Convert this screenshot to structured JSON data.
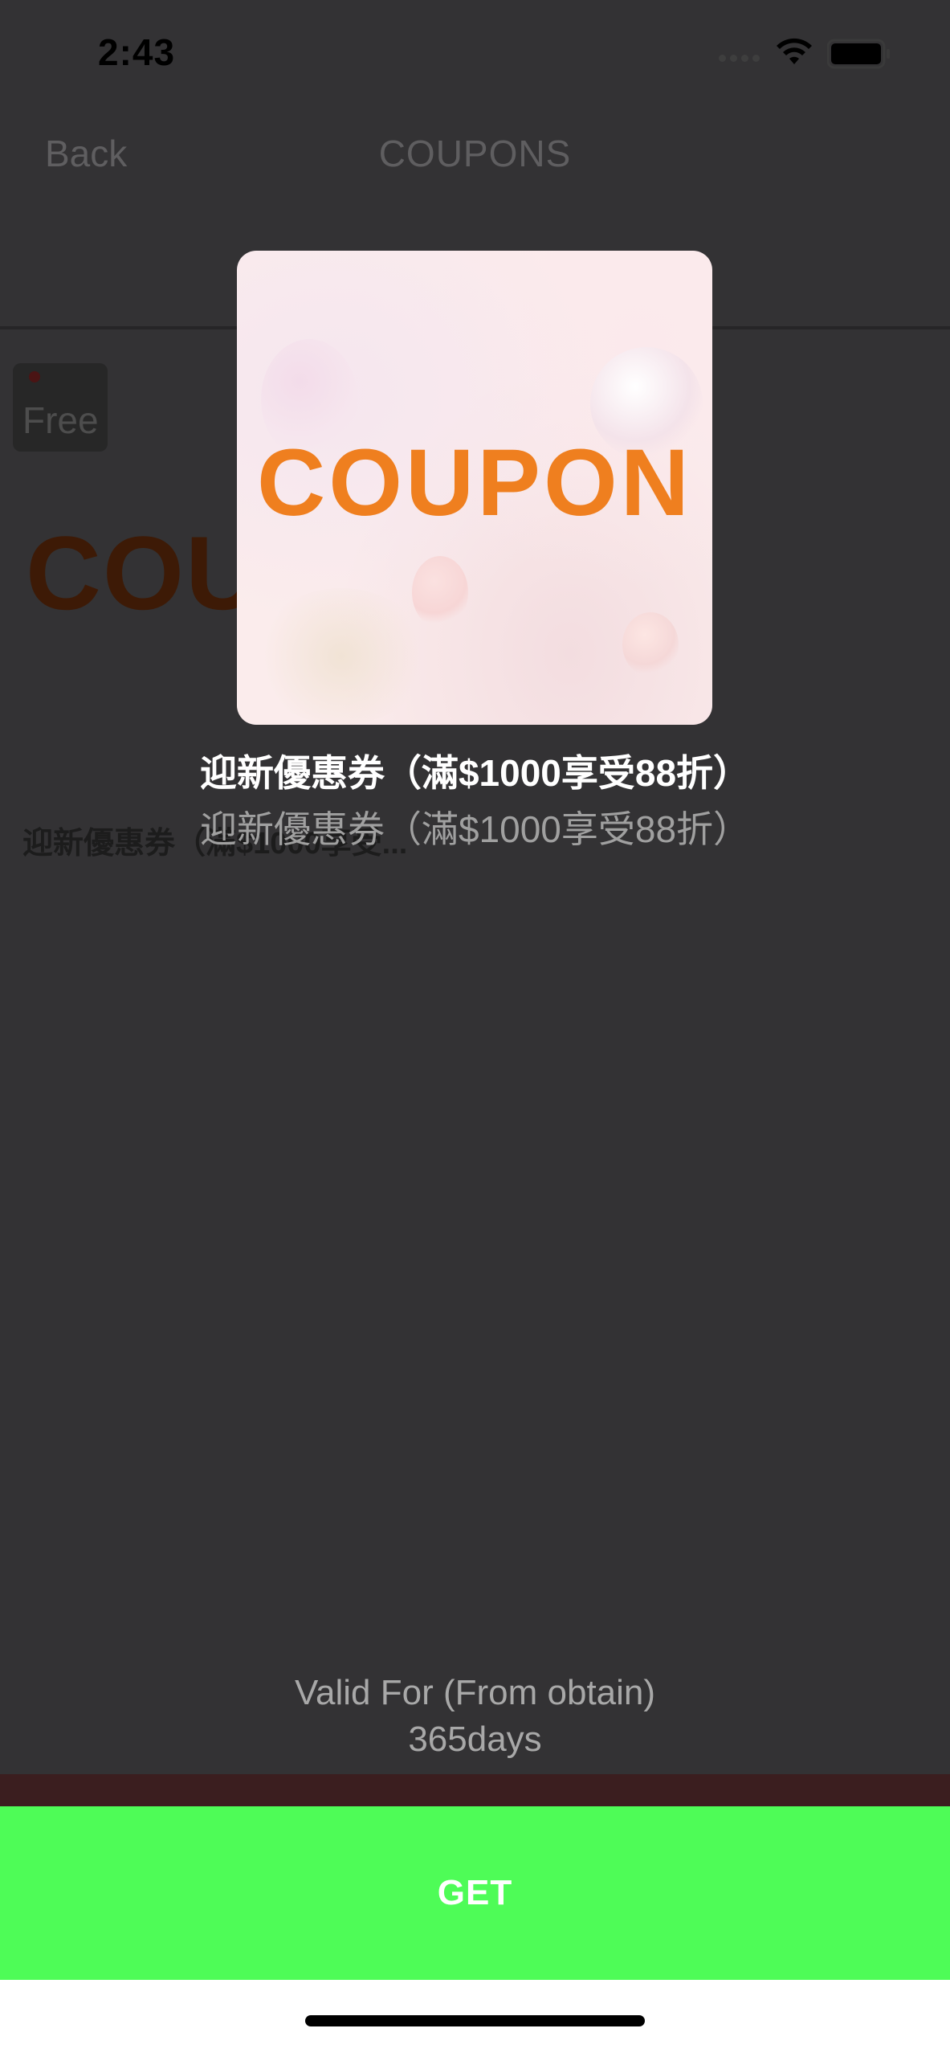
{
  "status_bar": {
    "time": "2:43",
    "icons": [
      "wifi-icon",
      "battery-icon"
    ]
  },
  "nav": {
    "back_label": "Back",
    "title": "COUPONS"
  },
  "background_card": {
    "badge": "Free",
    "logo_text": "COU",
    "title": "迎新優惠券（滿$1000享受..."
  },
  "modal": {
    "image_text": "COUPON",
    "title": "迎新優惠券（滿$1000享受88折）",
    "subtitle": "迎新優惠券（滿$1000享受88折）",
    "valid_label": "Valid For (From obtain)",
    "valid_value": "365days",
    "get_label": "GET"
  },
  "colors": {
    "overlay_bg": "#333234",
    "coupon_orange": "#ef7f1f",
    "get_button_green": "#4efc57",
    "coupon_image_bg": "#fbecec"
  }
}
